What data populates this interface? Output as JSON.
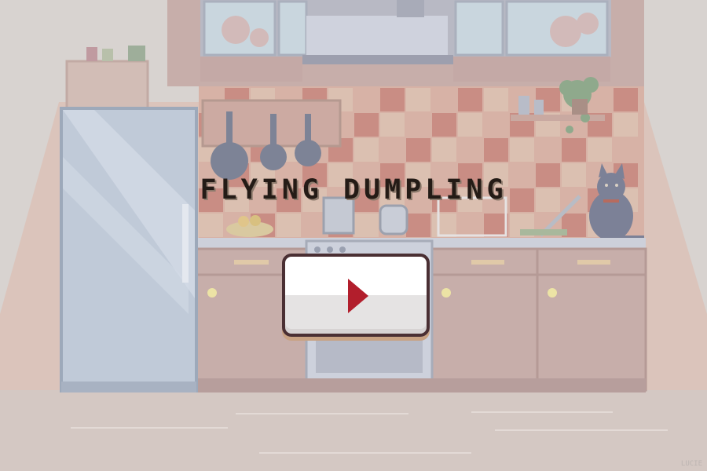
{
  "game": {
    "title": "FLYING DUMPLING",
    "play_button_label": "Play"
  },
  "watermark": "LUCIE",
  "colors": {
    "title_text": "#241b16",
    "play_triangle": "#b21e2c",
    "button_border": "#4a2f33"
  },
  "icons": {
    "play": "play-triangle-icon"
  }
}
